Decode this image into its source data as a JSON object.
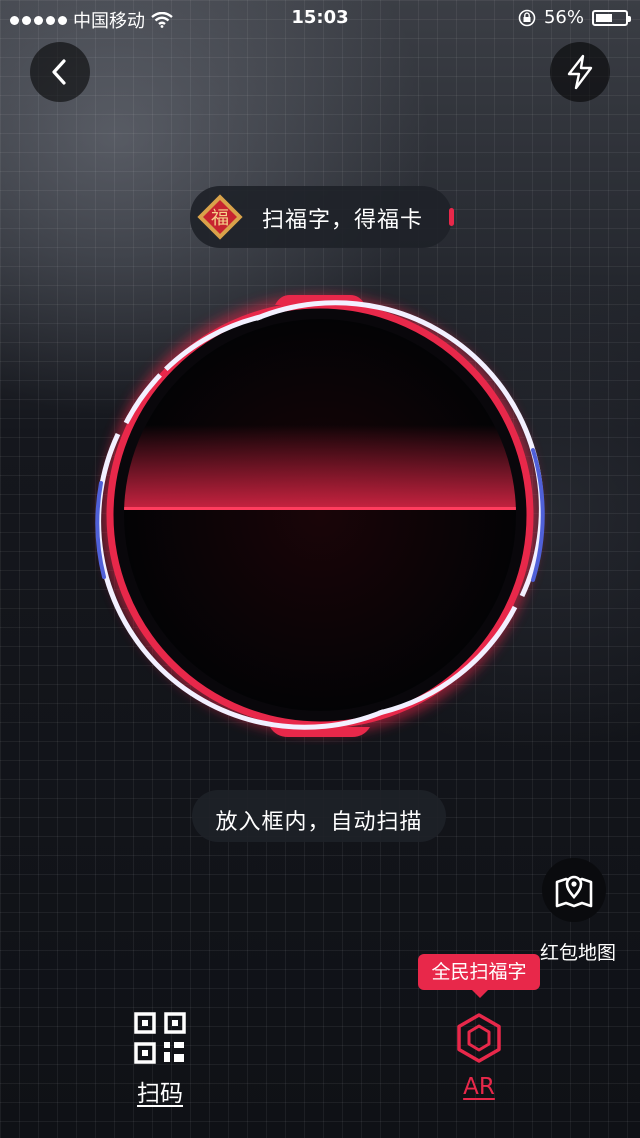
{
  "status_bar": {
    "carrier": "中国移动",
    "time": "15:03",
    "battery_percent": "56%",
    "battery_level": 0.56
  },
  "header": {
    "back_icon": "chevron-left-icon",
    "flash_icon": "lightning-icon"
  },
  "hint": {
    "badge_char": "福",
    "text": "扫福字，得福卡"
  },
  "instruction": "放入框内，自动扫描",
  "map": {
    "icon": "map-pin-icon",
    "label": "红包地图"
  },
  "promo_tag": "全民扫福字",
  "tabs": [
    {
      "label": "扫码",
      "icon": "qr-code-icon",
      "active": false
    },
    {
      "label": "AR",
      "icon": "hexagon-ar-icon",
      "active": true
    }
  ],
  "colors": {
    "accent": "#e8284a",
    "ring_white": "#f2f0ff",
    "ring_blue": "#5060d8"
  }
}
